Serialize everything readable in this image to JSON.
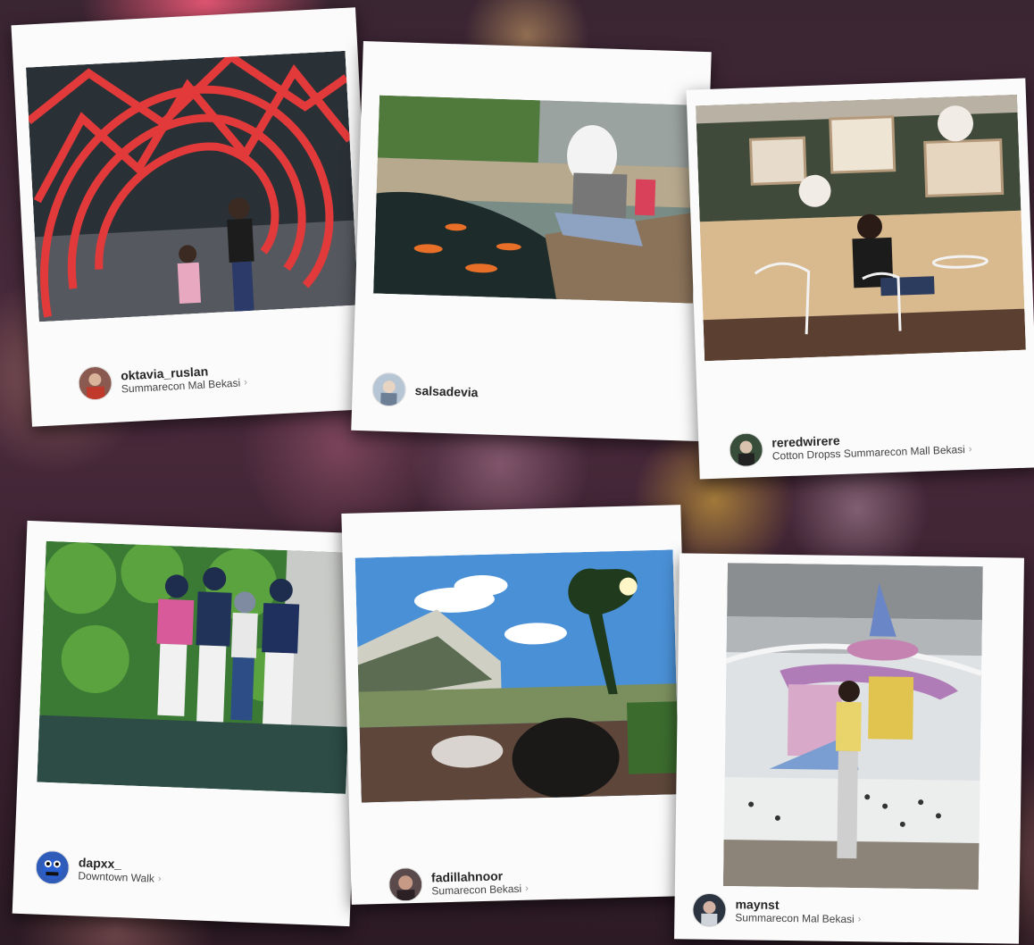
{
  "posts": [
    {
      "username": "oktavia_ruslan",
      "location": "Summarecon Mal Bekasi",
      "chevron": "›"
    },
    {
      "username": "salsadevia",
      "location": "",
      "chevron": ""
    },
    {
      "username": "reredwirere",
      "location": "Cotton Dropss Summarecon Mall Bekasi",
      "chevron": "›"
    },
    {
      "username": "dapxx_",
      "location": "Downtown Walk",
      "chevron": "›"
    },
    {
      "username": "fadillahnoor",
      "location": "Sumarecon Bekasi",
      "chevron": "›"
    },
    {
      "username": "maynst",
      "location": "Summarecon Mal Bekasi",
      "chevron": "›"
    }
  ],
  "icons": {
    "avatar": "user-avatar-icon",
    "chevron": "chevron-right-icon"
  }
}
